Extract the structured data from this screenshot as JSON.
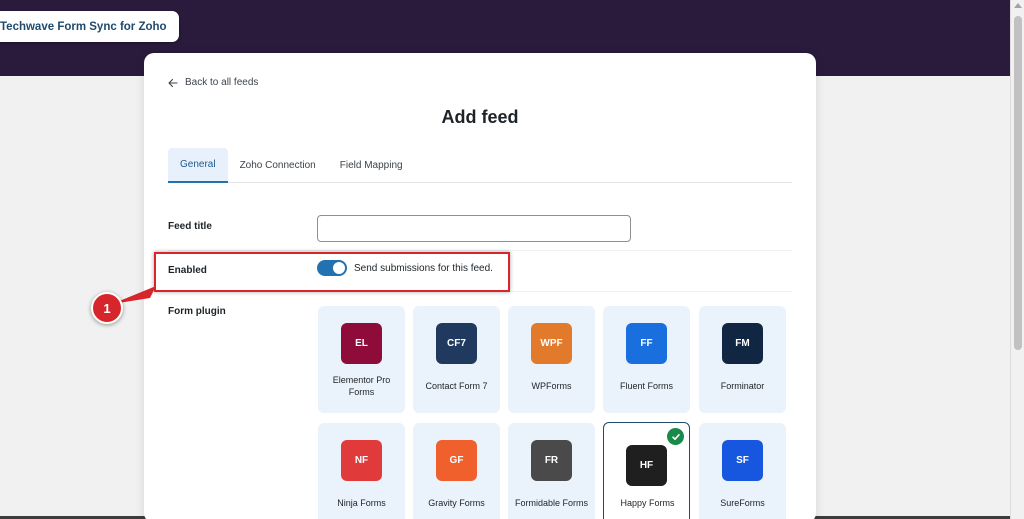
{
  "app": {
    "name": "Techwave Form Sync for Zoho"
  },
  "nav": {
    "back_label": "Back to all feeds"
  },
  "page": {
    "title": "Add feed"
  },
  "tabs": [
    {
      "label": "General",
      "active": true
    },
    {
      "label": "Zoho Connection",
      "active": false
    },
    {
      "label": "Field Mapping",
      "active": false
    }
  ],
  "form": {
    "feed_title": {
      "label": "Feed title",
      "value": "",
      "placeholder": ""
    },
    "enabled": {
      "label": "Enabled",
      "toggle_on": true,
      "description": "Send submissions for this feed."
    },
    "form_plugin": {
      "label": "Form plugin"
    }
  },
  "plugins": [
    {
      "abbr": "EL",
      "name": "Elementor Pro Forms",
      "color": "#8e0b3a",
      "selected": false
    },
    {
      "abbr": "CF7",
      "name": "Contact Form 7",
      "color": "#1f3a5e",
      "selected": false
    },
    {
      "abbr": "WPF",
      "name": "WPForms",
      "color": "#e37a2b",
      "selected": false
    },
    {
      "abbr": "FF",
      "name": "Fluent Forms",
      "color": "#1a6fde",
      "selected": false
    },
    {
      "abbr": "FM",
      "name": "Forminator",
      "color": "#102642",
      "selected": false
    },
    {
      "abbr": "NF",
      "name": "Ninja Forms",
      "color": "#e03a3a",
      "selected": false
    },
    {
      "abbr": "GF",
      "name": "Gravity Forms",
      "color": "#f0602d",
      "selected": false
    },
    {
      "abbr": "FR",
      "name": "Formidable Forms",
      "color": "#4a4a4a",
      "selected": false
    },
    {
      "abbr": "HF",
      "name": "Happy Forms",
      "color": "#1f1f1f",
      "selected": true
    },
    {
      "abbr": "SF",
      "name": "SureForms",
      "color": "#1757e0",
      "selected": false
    }
  ],
  "annotation": {
    "badge_number": "1",
    "color": "#d7262b"
  },
  "colors": {
    "header": "#2a1a3c",
    "accent": "#2271b1",
    "tile_bg": "#eaf2fb",
    "check": "#1a8a4a"
  }
}
